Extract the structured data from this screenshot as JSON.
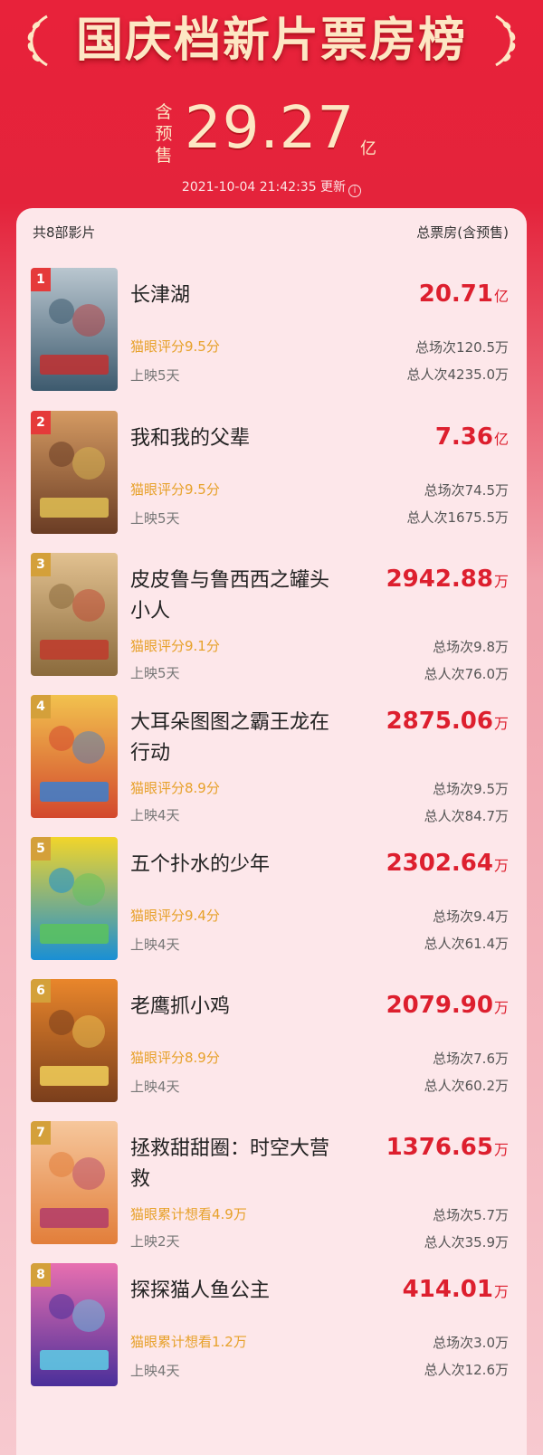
{
  "header": {
    "title": "国庆档新片票房榜",
    "presale_tag": [
      "含",
      "预",
      "售"
    ],
    "total": "29.27",
    "total_unit": "亿",
    "updated": "2021-10-04 21:42:35 更新",
    "info_icon": "info-circle-icon"
  },
  "panel": {
    "count_label": "共8部影片",
    "total_label": "总票房(含预售)"
  },
  "colors": {
    "header_red": "#e8223a",
    "gold_text": "#fde7c4",
    "box_red": "#dd1f2e",
    "rating_orange": "#e7a12a"
  },
  "movies": [
    {
      "rank": "1",
      "name": "长津湖",
      "rating": "猫眼评分9.5分",
      "days": "上映5天",
      "box": "20.71",
      "unit": "亿",
      "sessions": "总场次120.5万",
      "viewers": "总人次4235.0万"
    },
    {
      "rank": "2",
      "name": "我和我的父辈",
      "rating": "猫眼评分9.5分",
      "days": "上映5天",
      "box": "7.36",
      "unit": "亿",
      "sessions": "总场次74.5万",
      "viewers": "总人次1675.5万"
    },
    {
      "rank": "3",
      "name": "皮皮鲁与鲁西西之罐头小人",
      "rating": "猫眼评分9.1分",
      "days": "上映5天",
      "box": "2942.88",
      "unit": "万",
      "sessions": "总场次9.8万",
      "viewers": "总人次76.0万"
    },
    {
      "rank": "4",
      "name": "大耳朵图图之霸王龙在行动",
      "rating": "猫眼评分8.9分",
      "days": "上映4天",
      "box": "2875.06",
      "unit": "万",
      "sessions": "总场次9.5万",
      "viewers": "总人次84.7万"
    },
    {
      "rank": "5",
      "name": "五个扑水的少年",
      "rating": "猫眼评分9.4分",
      "days": "上映4天",
      "box": "2302.64",
      "unit": "万",
      "sessions": "总场次9.4万",
      "viewers": "总人次61.4万"
    },
    {
      "rank": "6",
      "name": "老鹰抓小鸡",
      "rating": "猫眼评分8.9分",
      "days": "上映4天",
      "box": "2079.90",
      "unit": "万",
      "sessions": "总场次7.6万",
      "viewers": "总人次60.2万"
    },
    {
      "rank": "7",
      "name": "拯救甜甜圈：时空大营救",
      "rating": "猫眼累计想看4.9万",
      "days": "上映2天",
      "box": "1376.65",
      "unit": "万",
      "sessions": "总场次5.7万",
      "viewers": "总人次35.9万"
    },
    {
      "rank": "8",
      "name": "探探猫人鱼公主",
      "rating": "猫眼累计想看1.2万",
      "days": "上映4天",
      "box": "414.01",
      "unit": "万",
      "sessions": "总场次3.0万",
      "viewers": "总人次12.6万"
    }
  ]
}
